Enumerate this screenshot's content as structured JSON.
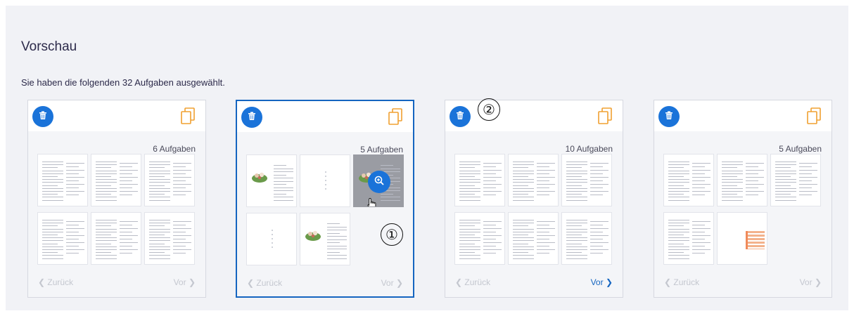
{
  "page": {
    "title": "Vorschau",
    "subtitle": "Sie haben die folgenden 32 Aufgaben ausgewählt."
  },
  "cards": [
    {
      "count": "6 Aufgaben",
      "prev": "Zurück",
      "next": "Vor",
      "selected": false,
      "next_active": false,
      "thumbs": [
        "text",
        "text",
        "text",
        "text",
        "text",
        "text"
      ]
    },
    {
      "count": "5 Aufgaben",
      "prev": "Zurück",
      "next": "Vor",
      "selected": true,
      "next_active": false,
      "thumbs": [
        "image",
        "blank",
        "image-hover",
        "blank",
        "image"
      ]
    },
    {
      "count": "10 Aufgaben",
      "prev": "Zurück",
      "next": "Vor",
      "selected": false,
      "next_active": true,
      "thumbs": [
        "text",
        "text",
        "text",
        "text",
        "text",
        "text"
      ]
    },
    {
      "count": "5 Aufgaben",
      "prev": "Zurück",
      "next": "Vor",
      "selected": false,
      "next_active": false,
      "thumbs": [
        "text",
        "text",
        "text",
        "text",
        "table"
      ]
    }
  ],
  "callouts": {
    "first": "①",
    "second": "②"
  },
  "icons": {
    "delete": "trash-icon",
    "copy": "copy-pages-icon",
    "zoom": "zoom-in-icon",
    "cursor": "hand-pointer-icon"
  },
  "colors": {
    "accent": "#1a73d9",
    "copy_icon": "#f0a030",
    "panel": "#f1f2f6"
  }
}
